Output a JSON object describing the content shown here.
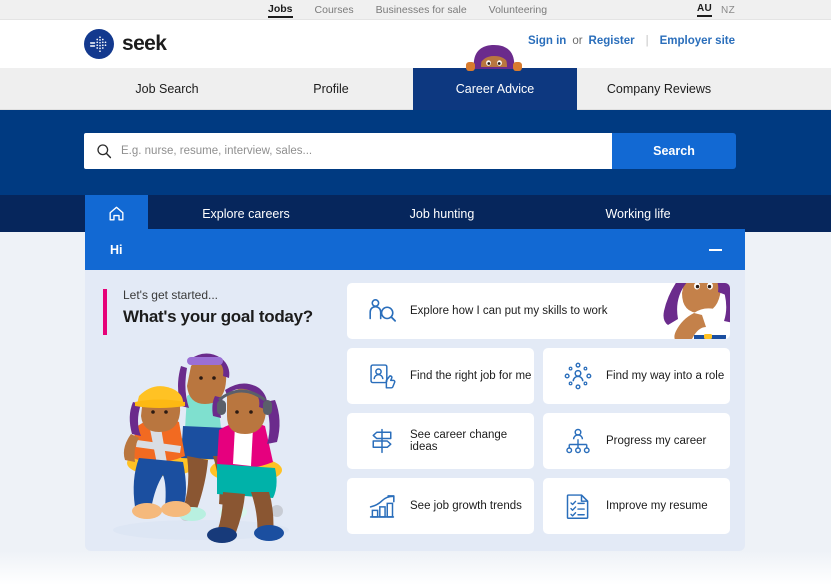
{
  "utility_bar": {
    "links": [
      {
        "label": "Jobs",
        "active": true
      },
      {
        "label": "Courses",
        "active": false
      },
      {
        "label": "Businesses for sale",
        "active": false
      },
      {
        "label": "Volunteering",
        "active": false
      }
    ],
    "locales": [
      {
        "label": "AU",
        "active": true
      },
      {
        "label": "NZ",
        "active": false
      }
    ]
  },
  "brand": {
    "wordmark": "seek",
    "logo_icon": "seek-dot-matrix-logo",
    "sign_in": "Sign in",
    "or": "or",
    "register": "Register",
    "separator": "|",
    "employer_site": "Employer site"
  },
  "tabs": [
    {
      "label": "Job Search",
      "active": false
    },
    {
      "label": "Profile",
      "active": false
    },
    {
      "label": "Career Advice",
      "active": true
    },
    {
      "label": "Company Reviews",
      "active": false
    }
  ],
  "search": {
    "icon": "search-icon",
    "value": "",
    "placeholder": "E.g. nurse, resume, interview, sales...",
    "button_label": "Search"
  },
  "subnav": {
    "home_icon": "home-icon",
    "items": [
      {
        "label": "Explore careers"
      },
      {
        "label": "Job hunting"
      },
      {
        "label": "Working life"
      }
    ]
  },
  "greeting_bar": {
    "text": "Hi",
    "collapse_icon": "minus-icon"
  },
  "panel": {
    "eyebrow": "Let's get started...",
    "headline": "What's your goal today?",
    "illustration": "three-people-sitting-on-stools-illustration",
    "cards": [
      {
        "label": "Explore how I can put my skills to work",
        "icon": "person-search-icon",
        "wide": true,
        "character": "woman-with-purple-hair-illustration"
      },
      {
        "label": "Find the right job for me",
        "icon": "person-card-thumbs-up-icon",
        "wide": false
      },
      {
        "label": "Find my way into a role",
        "icon": "person-network-nodes-icon",
        "wide": false
      },
      {
        "label": "See career change ideas",
        "icon": "signpost-icon",
        "wide": false
      },
      {
        "label": "Progress my career",
        "icon": "org-chart-icon",
        "wide": false
      },
      {
        "label": "See job growth trends",
        "icon": "bar-chart-arrow-up-icon",
        "wide": false
      },
      {
        "label": "Improve my resume",
        "icon": "checklist-document-icon",
        "wide": false
      }
    ]
  },
  "colors": {
    "brand_navy": "#0d3880",
    "hero_blue": "#003a81",
    "subnav_navy": "#06265c",
    "accent_blue": "#1269d3",
    "link_blue": "#2a6ebb",
    "pink_accent": "#e60278",
    "panel_bg": "#e3eaf6",
    "icon_blue": "#2a6ebb"
  }
}
